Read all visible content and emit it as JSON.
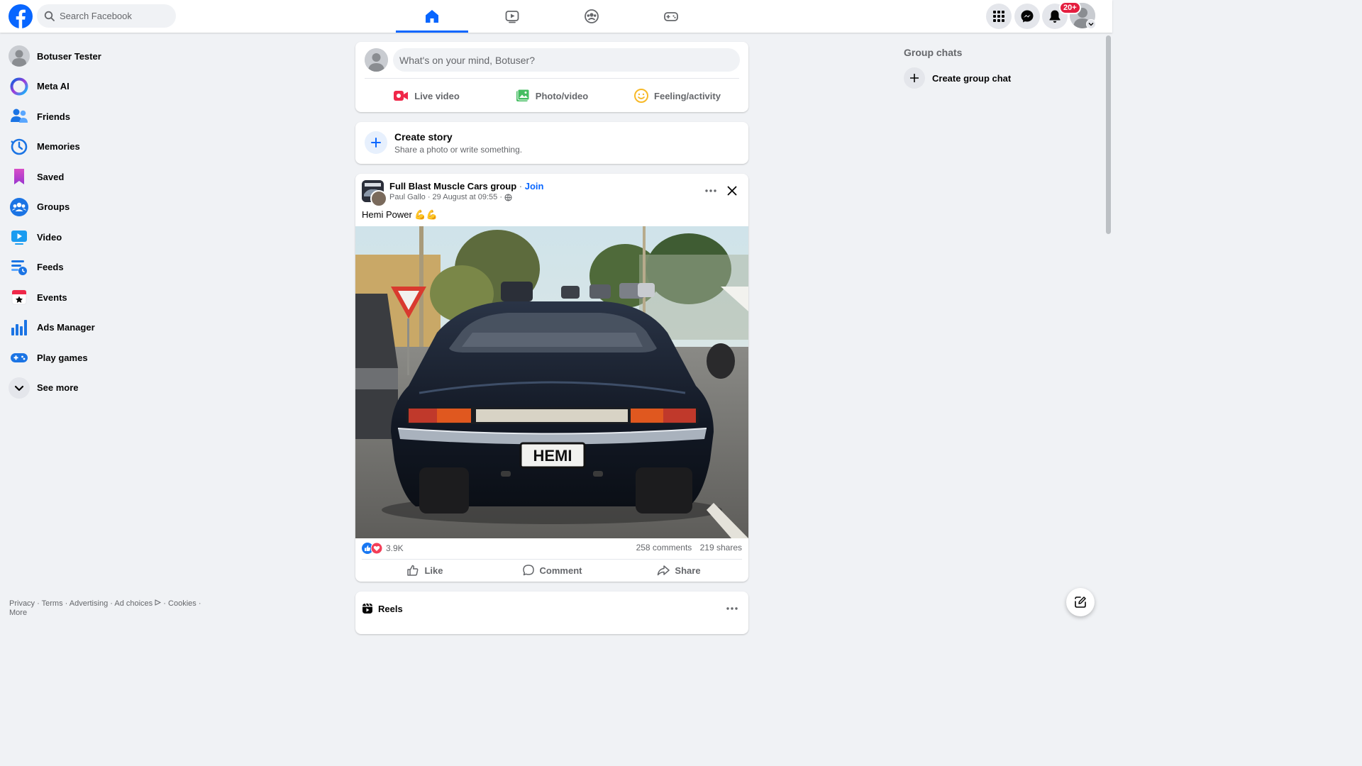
{
  "header": {
    "search_placeholder": "Search Facebook",
    "notification_badge": "20+",
    "nav_tabs": [
      {
        "name": "home",
        "icon": "home-icon",
        "active": true
      },
      {
        "name": "video",
        "icon": "video-icon"
      },
      {
        "name": "groups",
        "icon": "groups-icon"
      },
      {
        "name": "gaming",
        "icon": "gaming-icon"
      }
    ],
    "accent_color": "#0866ff"
  },
  "sidebar": {
    "items": [
      {
        "label": "Botuser Tester",
        "icon": "profile-avatar-icon"
      },
      {
        "label": "Meta AI",
        "icon": "meta-ai-icon"
      },
      {
        "label": "Friends",
        "icon": "friends-icon"
      },
      {
        "label": "Memories",
        "icon": "memories-clock-icon"
      },
      {
        "label": "Saved",
        "icon": "bookmark-icon"
      },
      {
        "label": "Groups",
        "icon": "groups-icon"
      },
      {
        "label": "Video",
        "icon": "video-play-icon"
      },
      {
        "label": "Feeds",
        "icon": "feeds-icon"
      },
      {
        "label": "Events",
        "icon": "calendar-star-icon"
      },
      {
        "label": "Ads Manager",
        "icon": "bar-chart-icon"
      },
      {
        "label": "Play games",
        "icon": "gamepad-icon"
      },
      {
        "label": "See more",
        "icon": "chevron-down-icon"
      }
    ],
    "footer": {
      "privacy": "Privacy",
      "terms": "Terms",
      "advertising": "Advertising",
      "ad_choices": "Ad choices",
      "cookies": "Cookies",
      "more": "More"
    }
  },
  "composer": {
    "placeholder": "What's on your mind, Botuser?",
    "live_video": "Live video",
    "photo_video": "Photo/video",
    "feeling": "Feeling/activity"
  },
  "story": {
    "title": "Create story",
    "subtitle": "Share a photo or write something."
  },
  "post": {
    "group": "Full Blast Muscle Cars group",
    "separator": " · ",
    "join": "Join",
    "author": "Paul Gallo",
    "time": "29 August at 09:55",
    "text": "Hemi Power 💪💪",
    "plate": "HEMI",
    "reactions": "3.9K",
    "comments": "258 comments",
    "shares": "219 shares",
    "like": "Like",
    "comment": "Comment",
    "share": "Share"
  },
  "reels": {
    "title": "Reels"
  },
  "right": {
    "group_chats_title": "Group chats",
    "create_group_chat": "Create group chat"
  }
}
